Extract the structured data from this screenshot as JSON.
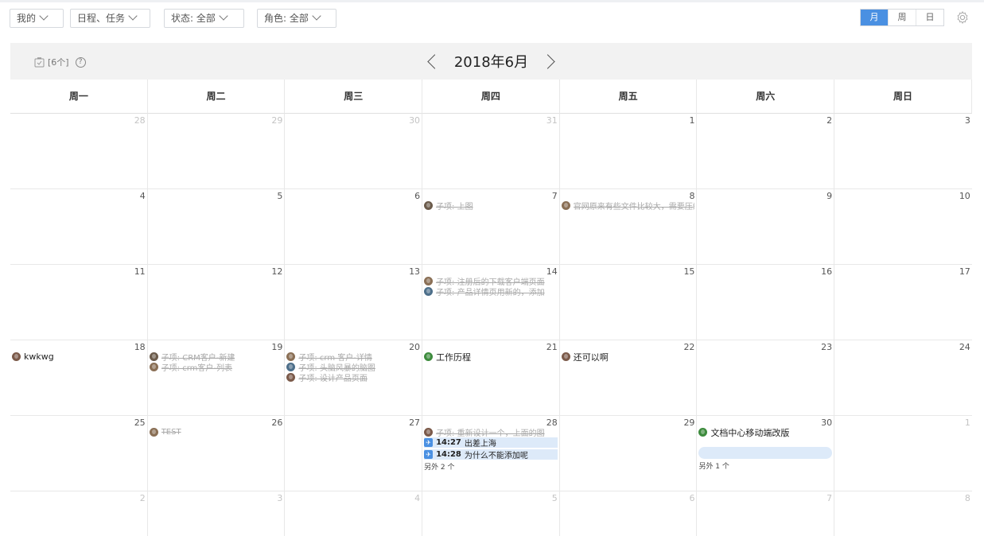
{
  "toolbar": {
    "filters": [
      {
        "label": "我的"
      },
      {
        "label": "日程、任务"
      },
      {
        "label": "状态: 全部"
      },
      {
        "label": "角色: 全部"
      }
    ],
    "views": [
      {
        "label": "月",
        "active": true
      },
      {
        "label": "周",
        "active": false
      },
      {
        "label": "日",
        "active": false
      }
    ],
    "settings_icon": "gear-icon"
  },
  "header": {
    "task_count": "[6个]",
    "help": "?",
    "month_title": "2018年6月",
    "task_icon": "task-list-icon"
  },
  "weekdays": [
    "周一",
    "周二",
    "周三",
    "周四",
    "周五",
    "周六",
    "周日"
  ],
  "colors": {
    "accent": "#4a90e2",
    "done_text": "#aaaaaa",
    "event_bg": "#ddeaf9"
  },
  "weeks": [
    [
      {
        "day": "28",
        "other": true,
        "events": []
      },
      {
        "day": "29",
        "other": true,
        "events": []
      },
      {
        "day": "30",
        "other": true,
        "events": []
      },
      {
        "day": "31",
        "other": true,
        "events": []
      },
      {
        "day": "1",
        "events": []
      },
      {
        "day": "2",
        "events": []
      },
      {
        "day": "3",
        "events": []
      }
    ],
    [
      {
        "day": "4",
        "events": []
      },
      {
        "day": "5",
        "events": []
      },
      {
        "day": "6",
        "events": []
      },
      {
        "day": "7",
        "events": [
          {
            "kind": "done",
            "text": "子项: 上图"
          }
        ]
      },
      {
        "day": "8",
        "events": [
          {
            "kind": "done",
            "text": "官网原来有些文件比较大，需要压缩"
          }
        ]
      },
      {
        "day": "9",
        "events": []
      },
      {
        "day": "10",
        "events": []
      }
    ],
    [
      {
        "day": "11",
        "events": []
      },
      {
        "day": "12",
        "events": []
      },
      {
        "day": "13",
        "events": []
      },
      {
        "day": "14",
        "events": [
          {
            "kind": "done",
            "text": "子项: 注册后的下载客户端页面"
          },
          {
            "kind": "done",
            "text": "子项: 产品详情页用新的，添加"
          }
        ]
      },
      {
        "day": "15",
        "events": []
      },
      {
        "day": "16",
        "events": []
      },
      {
        "day": "17",
        "events": []
      }
    ],
    [
      {
        "day": "18",
        "events": [
          {
            "kind": "plain",
            "text": "kwkwg"
          }
        ]
      },
      {
        "day": "19",
        "events": [
          {
            "kind": "done",
            "text": "子项: CRM客户-新建"
          },
          {
            "kind": "done",
            "text": "子项: crm客户-列表"
          }
        ]
      },
      {
        "day": "20",
        "events": [
          {
            "kind": "done",
            "text": "子项: crm 客户-详情"
          },
          {
            "kind": "done",
            "text": "子项: 头脑风暴的脑图"
          },
          {
            "kind": "done",
            "text": "子项: 设计产品页面"
          }
        ]
      },
      {
        "day": "21",
        "events": [
          {
            "kind": "plain",
            "text": "工作历程",
            "avatar": "green"
          }
        ]
      },
      {
        "day": "22",
        "events": [
          {
            "kind": "plain",
            "text": "还可以啊"
          }
        ]
      },
      {
        "day": "23",
        "events": []
      },
      {
        "day": "24",
        "events": []
      }
    ],
    [
      {
        "day": "25",
        "events": []
      },
      {
        "day": "26",
        "events": [
          {
            "kind": "done",
            "text": "TEST"
          }
        ]
      },
      {
        "day": "27",
        "events": []
      },
      {
        "day": "28",
        "events": [
          {
            "kind": "done",
            "text": "子项: 重新设计一个，上面的图"
          },
          {
            "kind": "sched",
            "time": "14:27",
            "text": "出差上海"
          },
          {
            "kind": "sched",
            "time": "14:28",
            "text": "为什么不能添加呢"
          }
        ],
        "more": "另外 2 个"
      },
      {
        "day": "29",
        "events": []
      },
      {
        "day": "30",
        "events": [
          {
            "kind": "plain",
            "text": "文档中心移动端改版",
            "avatar": "green"
          }
        ],
        "emptybar": true,
        "more": "另外 1 个"
      },
      {
        "day": "1",
        "other": true,
        "events": []
      }
    ],
    [
      {
        "day": "2",
        "other": true,
        "events": []
      },
      {
        "day": "3",
        "other": true,
        "events": []
      },
      {
        "day": "4",
        "other": true,
        "events": []
      },
      {
        "day": "5",
        "other": true,
        "events": []
      },
      {
        "day": "6",
        "other": true,
        "events": []
      },
      {
        "day": "7",
        "other": true,
        "events": []
      },
      {
        "day": "8",
        "other": true,
        "events": []
      }
    ]
  ]
}
